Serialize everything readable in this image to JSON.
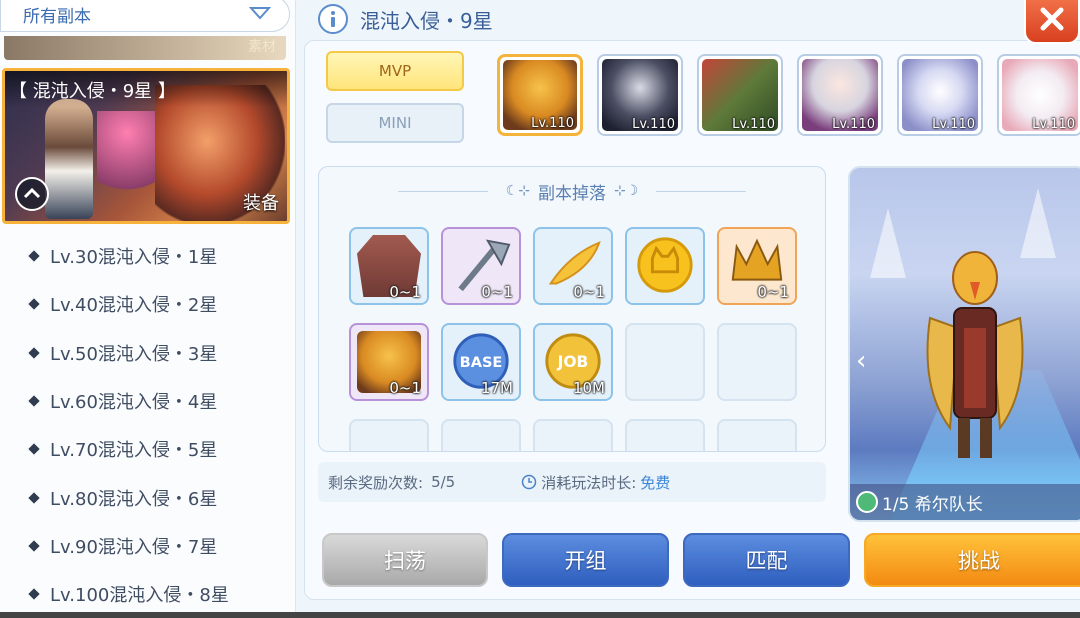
{
  "left_panel": {
    "dropdown_label": "所有副本",
    "strip_above_text": "素材",
    "active_card": {
      "title": "【 混沌入侵・9星 】",
      "equip_label": "装备"
    },
    "dungeons": [
      "Lv.30混沌入侵・1星",
      "Lv.40混沌入侵・2星",
      "Lv.50混沌入侵・3星",
      "Lv.60混沌入侵・4星",
      "Lv.70混沌入侵・5星",
      "Lv.80混沌入侵・6星",
      "Lv.90混沌入侵・7星",
      "Lv.100混沌入侵・8星"
    ]
  },
  "header": {
    "title": "混沌入侵・9星"
  },
  "tabs": {
    "mvp": "MVP",
    "mini": "MINI"
  },
  "bosses": [
    {
      "level": "Lv.110",
      "icon": "bird-boss-portrait",
      "selected": true
    },
    {
      "level": "Lv.110",
      "icon": "dark-skull-boss-portrait"
    },
    {
      "level": "Lv.110",
      "icon": "green-dragon-boss-portrait"
    },
    {
      "level": "Lv.110",
      "icon": "white-hair-boss-portrait"
    },
    {
      "level": "Lv.110",
      "icon": "crystal-egg-boss-portrait"
    },
    {
      "level": "Lv.110",
      "icon": "white-ghost-boss-portrait"
    }
  ],
  "drops": {
    "heading": "副本掉落",
    "items": [
      {
        "qty": "0~1",
        "icon": "armor-icon",
        "rarity": "blue"
      },
      {
        "qty": "0~1",
        "icon": "axe-icon",
        "rarity": "purple"
      },
      {
        "qty": "0~1",
        "icon": "feather-icon",
        "rarity": "blue"
      },
      {
        "qty": "",
        "icon": "cat-coin-icon",
        "rarity": "blue"
      },
      {
        "qty": "0~1",
        "icon": "golden-crown-icon",
        "rarity": "orange"
      },
      {
        "qty": "0~1",
        "icon": "bird-card-icon",
        "rarity": "purple"
      },
      {
        "qty": "17M",
        "icon": "base-exp-icon",
        "rarity": "blue",
        "text": "BASE"
      },
      {
        "qty": "10M",
        "icon": "job-exp-icon",
        "rarity": "blue",
        "text": "JOB"
      }
    ]
  },
  "info": {
    "remaining_label": "剩余奖励次数:",
    "remaining_value": "5/5",
    "cost_label": "消耗玩法时长:",
    "cost_value": "免费"
  },
  "preview": {
    "caption": "1/5 希尔队长"
  },
  "actions": {
    "sweep": "扫荡",
    "team": "开组",
    "match": "匹配",
    "challenge": "挑战"
  },
  "colors": {
    "accent_blue": "#3a5f98",
    "selected_border": "#f4b33a",
    "challenge": "#f38a12",
    "free_text": "#3c86d8"
  }
}
